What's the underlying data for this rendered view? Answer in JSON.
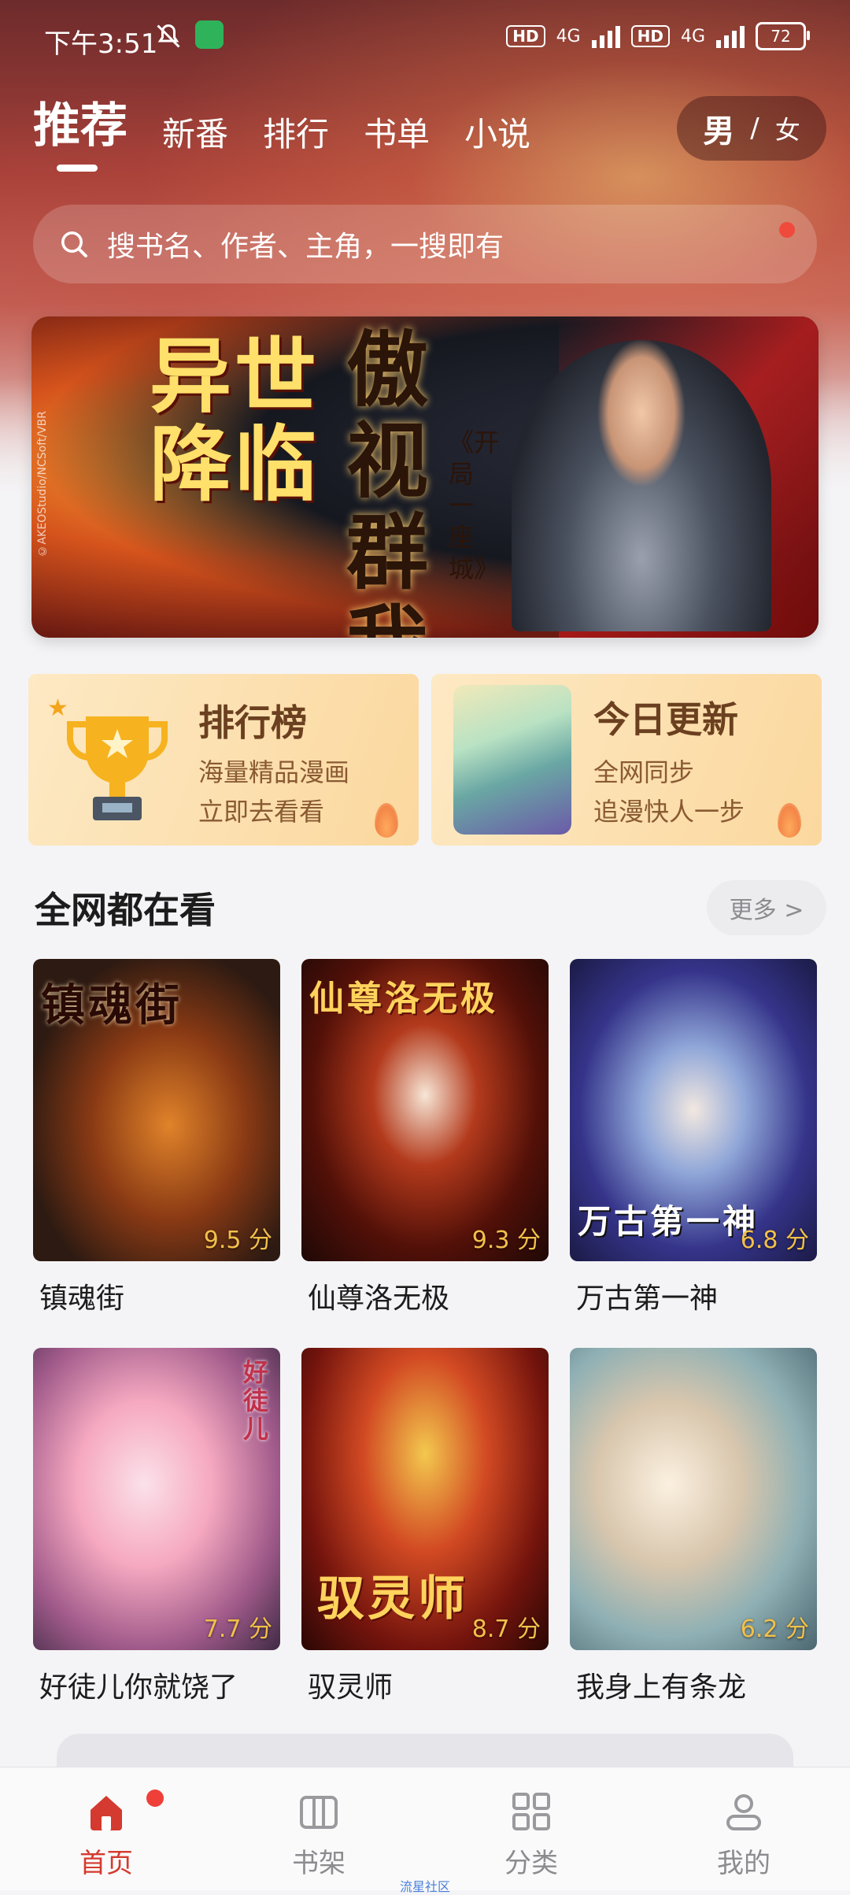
{
  "status_bar": {
    "time": "下午3:51",
    "network1": "4G",
    "network2": "4G",
    "hd1": "HD",
    "hd2": "HD",
    "battery": "72"
  },
  "top_tabs": [
    "推荐",
    "新番",
    "排行",
    "书单",
    "小说"
  ],
  "gender": {
    "male": "男",
    "separator": "/",
    "female": "女"
  },
  "search": {
    "placeholder": "搜书名、作者、主角，一搜即有"
  },
  "banner": {
    "title_left": "异世降临",
    "title_right": "傲视群我",
    "subtitle": "《开局一座城》",
    "credit": "©AKEOStudio/NCSoft/VBR"
  },
  "quick_cards": {
    "rank": {
      "title": "排行榜",
      "line1": "海量精品漫画",
      "line2": "立即去看看"
    },
    "update": {
      "title": "今日更新",
      "line1": "全网同步",
      "line2": "追漫快人一步"
    }
  },
  "section": {
    "title": "全网都在看",
    "more": "更多 >"
  },
  "comics": [
    {
      "name": "镇魂街",
      "score": "9.5 分",
      "cover_text": "镇魂街"
    },
    {
      "name": "仙尊洛无极",
      "score": "9.3 分",
      "cover_text": "仙尊洛无极"
    },
    {
      "name": "万古第一神",
      "score": "6.8 分",
      "cover_text": "万古第一神"
    },
    {
      "name": "好徒儿你就饶了",
      "score": "7.7 分",
      "cover_text": "好徒儿"
    },
    {
      "name": "驭灵师",
      "score": "8.7 分",
      "cover_text": "驭灵师"
    },
    {
      "name": "我身上有条龙",
      "score": "6.2 分",
      "cover_text": ""
    }
  ],
  "bottom_nav": [
    {
      "label": "首页",
      "icon": "home-icon"
    },
    {
      "label": "书架",
      "icon": "bookshelf-icon"
    },
    {
      "label": "分类",
      "icon": "category-grid-icon"
    },
    {
      "label": "我的",
      "icon": "profile-icon"
    }
  ],
  "watermark": "流星社区",
  "colors": {
    "accent": "#d43a2f",
    "score": "#f2c04a",
    "badge": "#ee4038"
  }
}
